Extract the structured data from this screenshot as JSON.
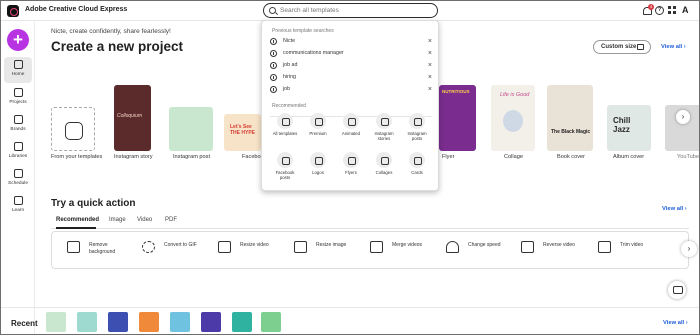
{
  "app": {
    "brand": "Adobe Creative Cloud Express",
    "search_placeholder": "Search all templates",
    "notification_count": "4",
    "help_icon_text": "?",
    "adobe_mark": "A"
  },
  "sidebar": {
    "create_button": "+",
    "items": [
      {
        "label": "Home",
        "icon": "home-icon"
      },
      {
        "label": "Projects",
        "icon": "projects-icon"
      },
      {
        "label": "Brands",
        "icon": "brands-icon"
      },
      {
        "label": "Libraries",
        "icon": "libraries-icon"
      },
      {
        "label": "Schedule",
        "icon": "schedule-icon"
      },
      {
        "label": "Learn",
        "icon": "learn-icon"
      }
    ]
  },
  "main": {
    "greeting": "Nicte, create confidently, share fearlessly!",
    "heading": "Create a new project",
    "custom_size": "Custom size",
    "view_all": "View all",
    "view_all_arrow": "›",
    "templates": [
      {
        "label": "From your templates"
      },
      {
        "label": "Instagram story",
        "thumb_text": "Colloquium"
      },
      {
        "label": "Instagram post"
      },
      {
        "label": "Facebook",
        "thumb_text": "Let's See THE HYPE"
      },
      {
        "label": "Flyer",
        "thumb_text": "NUTRITIOUS"
      },
      {
        "label": "Collage",
        "thumb_text": "Life is Good"
      },
      {
        "label": "Book cover",
        "thumb_text": "The Black Magic"
      },
      {
        "label": "Album cover",
        "thumb_text": "Chill Jazz"
      },
      {
        "label": "YouTube"
      }
    ],
    "carousel_next": "›"
  },
  "dropdown": {
    "previous_heading": "Previous template searches",
    "previous": [
      "Nicte",
      "communications manager",
      "job ad",
      "hiring",
      "job"
    ],
    "remove_icon": "×",
    "recommended_heading": "Recommended",
    "recommended": [
      {
        "label": "All templates"
      },
      {
        "label": "Premium"
      },
      {
        "label": "Animated"
      },
      {
        "label": "Instagram stories"
      },
      {
        "label": "Instagram posts"
      },
      {
        "label": "Facebook posts"
      },
      {
        "label": "Logos"
      },
      {
        "label": "Flyers"
      },
      {
        "label": "Collages"
      },
      {
        "label": "Cards"
      }
    ]
  },
  "quick_action": {
    "heading": "Try a quick action",
    "view_all": "View all",
    "view_all_arrow": "›",
    "tabs": [
      "Recommended",
      "Image",
      "Video",
      "PDF"
    ],
    "actions": [
      {
        "label": "Remove background",
        "icon": "remove-background-icon"
      },
      {
        "label": "Convert to GIF",
        "icon": "convert-gif-icon"
      },
      {
        "label": "Resize video",
        "icon": "resize-video-icon"
      },
      {
        "label": "Resize image",
        "icon": "resize-image-icon"
      },
      {
        "label": "Merge videos",
        "icon": "merge-videos-icon"
      },
      {
        "label": "Change speed",
        "icon": "change-speed-icon"
      },
      {
        "label": "Reverse video",
        "icon": "reverse-video-icon"
      },
      {
        "label": "Trim video",
        "icon": "trim-video-icon"
      }
    ],
    "next": "›"
  },
  "recent": {
    "label": "Recent",
    "view_all": "View all",
    "view_all_arrow": "›"
  },
  "colors": {
    "accent": "#b834e2",
    "link": "#1d5fd6"
  }
}
